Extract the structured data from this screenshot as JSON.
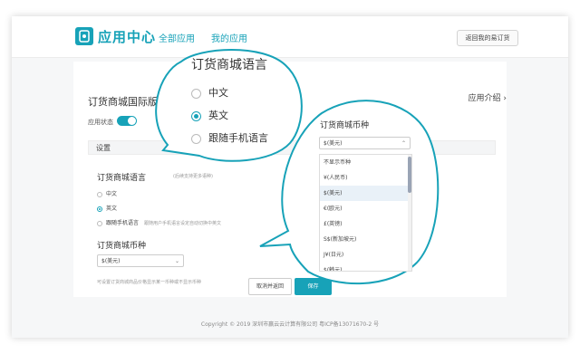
{
  "header": {
    "logo_text": "应用中心",
    "nav": [
      "全部应用",
      "我的应用"
    ],
    "back_button": "返回我的易订货"
  },
  "card": {
    "title": "订货商城国际版",
    "intro_link": "应用介绍",
    "status_label": "应用状态",
    "section_label": "设置",
    "language": {
      "title": "订货商城语言",
      "hint": "(后续支持更多语种)",
      "options": [
        "中文",
        "英文",
        "跟随手机语言"
      ],
      "selected_index": 1,
      "follow_hint": "跟随用户手机语言设定自动切换中英文"
    },
    "currency": {
      "title": "订货商城币种",
      "selected": "$(美元)",
      "hint": "可设置订货商城商品价格显示某一币种或不显示币种"
    },
    "cancel_button": "取消并返回",
    "save_button": "保存"
  },
  "footer": {
    "copyright": "Copyright © 2019 深圳市赢云云计算有限公司 粤ICP备13071670-2 号"
  },
  "zoom_language": {
    "title": "订货商城语言",
    "options": [
      "中文",
      "英文",
      "跟随手机语言"
    ]
  },
  "zoom_currency": {
    "title": "订货商城币种",
    "selected": "$(美元)",
    "options": [
      "不显示币种",
      "¥(人民币)",
      "$(美元)",
      "€(欧元)",
      "£(英镑)",
      "S$(新加坡元)",
      "J¥(日元)",
      "$(韩元)"
    ],
    "highlighted_index": 2
  },
  "colors": {
    "accent": "#17a2b8"
  }
}
